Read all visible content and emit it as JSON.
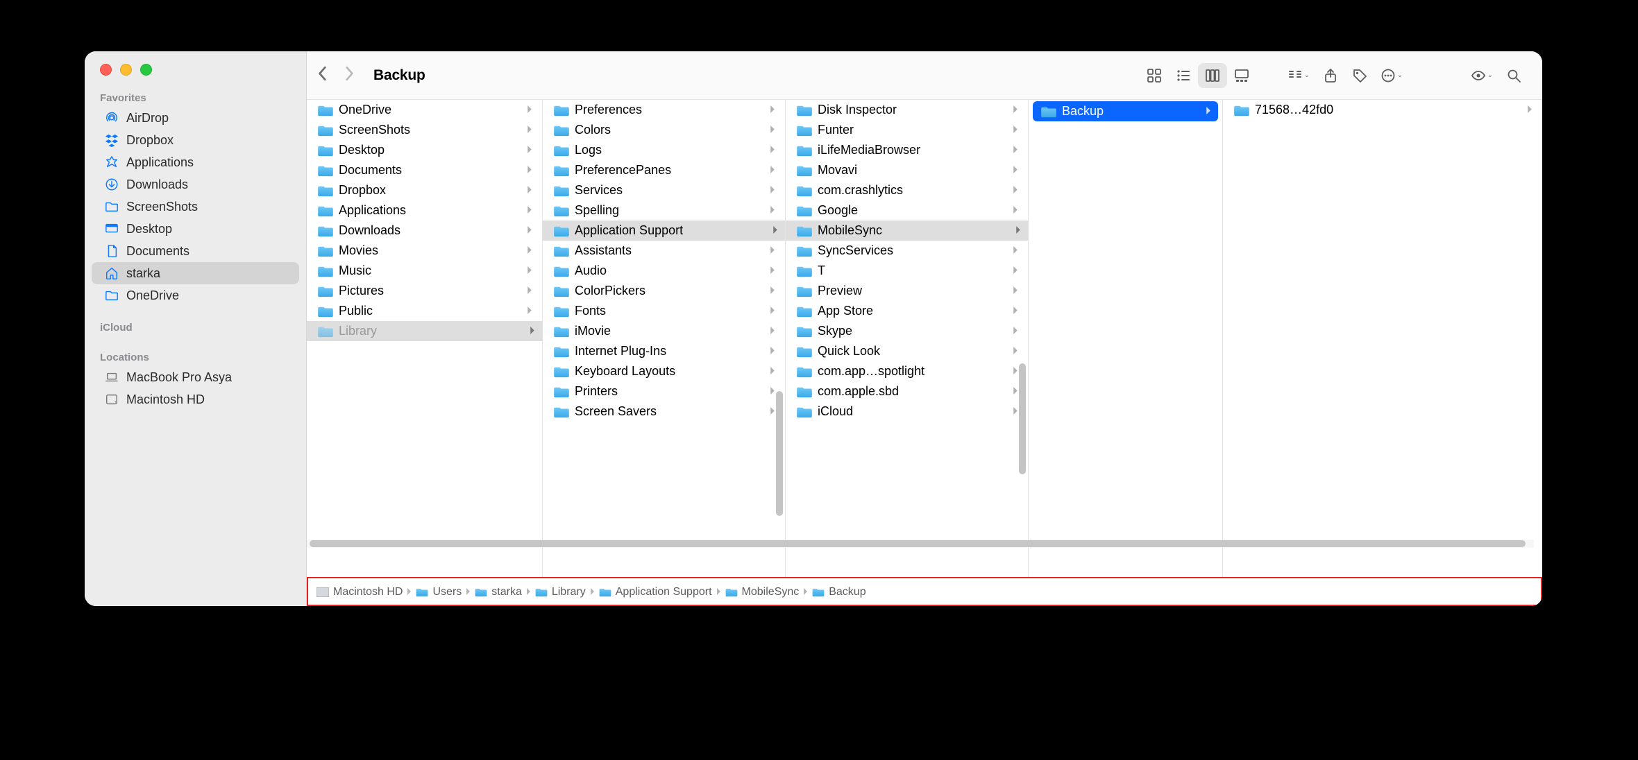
{
  "window_title": "Backup",
  "sidebar": {
    "sections": [
      {
        "label": "Favorites",
        "items": [
          {
            "icon": "airdrop",
            "label": "AirDrop"
          },
          {
            "icon": "dropbox",
            "label": "Dropbox"
          },
          {
            "icon": "app",
            "label": "Applications"
          },
          {
            "icon": "download",
            "label": "Downloads"
          },
          {
            "icon": "folder",
            "label": "ScreenShots"
          },
          {
            "icon": "desktop",
            "label": "Desktop"
          },
          {
            "icon": "doc",
            "label": "Documents"
          },
          {
            "icon": "home",
            "label": "starka",
            "selected": true
          },
          {
            "icon": "folder",
            "label": "OneDrive"
          }
        ]
      },
      {
        "label": "iCloud",
        "items": []
      },
      {
        "label": "Locations",
        "items": [
          {
            "icon": "laptop",
            "label": "MacBook Pro Asya",
            "grey": true
          },
          {
            "icon": "disk",
            "label": "Macintosh HD",
            "grey": true
          }
        ]
      }
    ]
  },
  "columns": [
    {
      "items": [
        {
          "label": "OneDrive"
        },
        {
          "label": "ScreenShots"
        },
        {
          "label": "Desktop"
        },
        {
          "label": "Documents"
        },
        {
          "label": "Dropbox"
        },
        {
          "label": "Applications"
        },
        {
          "label": "Downloads"
        },
        {
          "label": "Movies"
        },
        {
          "label": "Music"
        },
        {
          "label": "Pictures"
        },
        {
          "label": "Public"
        },
        {
          "label": "Library",
          "dim": true,
          "selected": "grey"
        }
      ]
    },
    {
      "items": [
        {
          "label": "Preferences"
        },
        {
          "label": "Colors"
        },
        {
          "label": "Logs"
        },
        {
          "label": "PreferencePanes"
        },
        {
          "label": "Services"
        },
        {
          "label": "Spelling"
        },
        {
          "label": "Application Support",
          "selected": "grey"
        },
        {
          "label": "Assistants"
        },
        {
          "label": "Audio"
        },
        {
          "label": "ColorPickers"
        },
        {
          "label": "Fonts"
        },
        {
          "label": "iMovie"
        },
        {
          "label": "Internet Plug-Ins"
        },
        {
          "label": "Keyboard Layouts"
        },
        {
          "label": "Printers"
        },
        {
          "label": "Screen Savers"
        }
      ]
    },
    {
      "items": [
        {
          "label": "Disk Inspector"
        },
        {
          "label": "Funter"
        },
        {
          "label": "iLifeMediaBrowser"
        },
        {
          "label": "Movavi"
        },
        {
          "label": "com.crashlytics"
        },
        {
          "label": "Google"
        },
        {
          "label": "MobileSync",
          "selected": "grey"
        },
        {
          "label": "SyncServices"
        },
        {
          "label": "T"
        },
        {
          "label": "Preview"
        },
        {
          "label": "App Store"
        },
        {
          "label": "Skype"
        },
        {
          "label": "Quick Look"
        },
        {
          "label": "com.app…spotlight"
        },
        {
          "label": "com.apple.sbd"
        },
        {
          "label": "iCloud"
        }
      ]
    },
    {
      "items": [
        {
          "label": "Backup",
          "selected": "blue"
        }
      ]
    },
    {
      "items": [
        {
          "label": "71568…42fd0"
        }
      ]
    }
  ],
  "pathbar": [
    {
      "icon": "hd",
      "label": "Macintosh HD"
    },
    {
      "icon": "folder",
      "label": "Users"
    },
    {
      "icon": "folder",
      "label": "starka"
    },
    {
      "icon": "folder",
      "label": "Library"
    },
    {
      "icon": "folder",
      "label": "Application Support"
    },
    {
      "icon": "folder",
      "label": "MobileSync"
    },
    {
      "icon": "folder",
      "label": "Backup"
    }
  ]
}
